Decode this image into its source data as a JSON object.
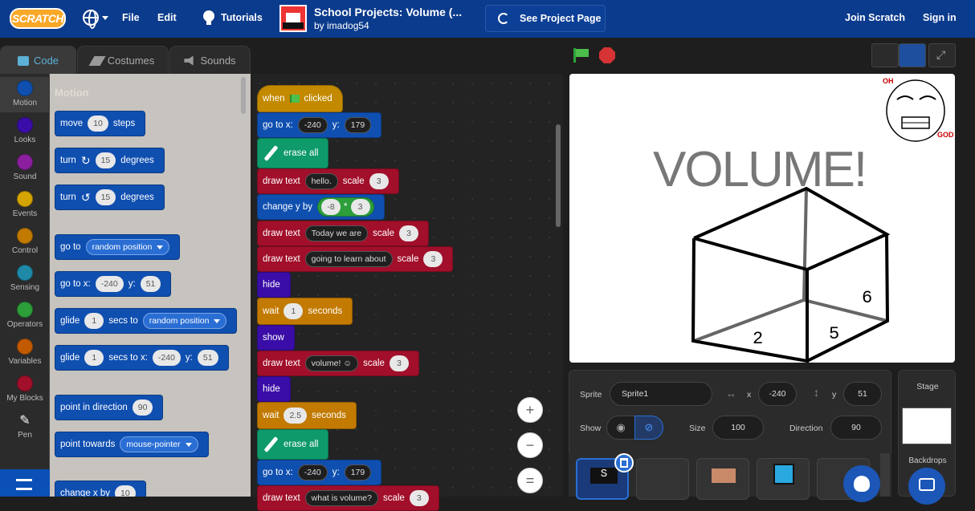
{
  "menubar": {
    "logo": "SCRATCH",
    "file": "File",
    "edit": "Edit",
    "tutorials": "Tutorials",
    "project_title": "School Projects: Volume (...",
    "project_author": "by imadog54",
    "see_project": "See Project Page",
    "join": "Join Scratch",
    "sign_in": "Sign in"
  },
  "tabs": {
    "code": "Code",
    "costumes": "Costumes",
    "sounds": "Sounds"
  },
  "categories": [
    {
      "label": "Motion",
      "color": "#0f4fb0"
    },
    {
      "label": "Looks",
      "color": "#3a0da8"
    },
    {
      "label": "Sound",
      "color": "#8b1f9e"
    },
    {
      "label": "Events",
      "color": "#d4a400"
    },
    {
      "label": "Control",
      "color": "#c27a00"
    },
    {
      "label": "Sensing",
      "color": "#1f8aa8"
    },
    {
      "label": "Operators",
      "color": "#2c9e3a"
    },
    {
      "label": "Variables",
      "color": "#c25a00"
    },
    {
      "label": "My Blocks",
      "color": "#a10f2a"
    },
    {
      "label": "Pen",
      "color": "#0e9a6a"
    }
  ],
  "palette": {
    "heading": "Motion",
    "move": {
      "label": "move",
      "steps": "10",
      "suffix": "steps"
    },
    "turn_right": {
      "label": "turn",
      "deg": "15",
      "suffix": "degrees"
    },
    "turn_left": {
      "label": "turn",
      "deg": "15",
      "suffix": "degrees"
    },
    "goto": {
      "label": "go to",
      "target": "random position"
    },
    "gotoxy": {
      "label": "go to x:",
      "x": "-240",
      "ylabel": "y:",
      "y": "51"
    },
    "glide": {
      "label": "glide",
      "secs": "1",
      "mid": "secs to",
      "target": "random position"
    },
    "glidexy": {
      "label": "glide",
      "secs": "1",
      "mid": "secs to x:",
      "x": "-240",
      "ylabel": "y:",
      "y": "51"
    },
    "point_dir": {
      "label": "point in direction",
      "value": "90"
    },
    "point_towards": {
      "label": "point towards",
      "target": "mouse-pointer"
    },
    "change_x": {
      "label": "change x by",
      "value": "10"
    }
  },
  "script": {
    "when": "when",
    "clicked": "clicked",
    "goto1": {
      "label": "go to x:",
      "x": "-240",
      "ylabel": "y:",
      "y": "179"
    },
    "erase1": "erase all",
    "draw1": {
      "label": "draw text",
      "text": "hello.",
      "scale_label": "scale",
      "scale": "3"
    },
    "changey": {
      "label": "change y by",
      "a": "-8",
      "op": "*",
      "b": "3"
    },
    "draw2": {
      "label": "draw text",
      "text": "Today we are",
      "scale_label": "scale",
      "scale": "3"
    },
    "draw3": {
      "label": "draw text",
      "text": "going to learn about",
      "scale_label": "scale",
      "scale": "3"
    },
    "hide1": "hide",
    "wait1": {
      "label": "wait",
      "value": "1",
      "suffix": "seconds"
    },
    "show": "show",
    "draw4": {
      "label": "draw text",
      "text": "volume! ☺",
      "scale_label": "scale",
      "scale": "3"
    },
    "hide2": "hide",
    "wait2": {
      "label": "wait",
      "value": "2.5",
      "suffix": "seconds"
    },
    "erase2": "erase all",
    "goto2": {
      "label": "go to x:",
      "x": "-240",
      "ylabel": "y:",
      "y": "179"
    },
    "draw5": {
      "label": "draw text",
      "text": "what is volume?",
      "scale_label": "scale",
      "scale": "3"
    }
  },
  "zoom": {
    "in": "+",
    "out": "−",
    "reset": "="
  },
  "stage_canvas": {
    "title": "VOLUME!",
    "oh": "OH",
    "god": "GOD",
    "n2": "2",
    "n5": "5",
    "n6": "6"
  },
  "sprite_info": {
    "sprite_label": "Sprite",
    "sprite_name": "Sprite1",
    "x_label": "x",
    "x": "-240",
    "y_label": "y",
    "y": "51",
    "show_label": "Show",
    "size_label": "Size",
    "size": "100",
    "direction_label": "Direction",
    "direction": "90"
  },
  "stage_panel": {
    "title": "Stage",
    "backdrops": "Backdrops"
  },
  "colors": {
    "menubar": "#0b3b8c",
    "accent": "#2a6ed4"
  }
}
